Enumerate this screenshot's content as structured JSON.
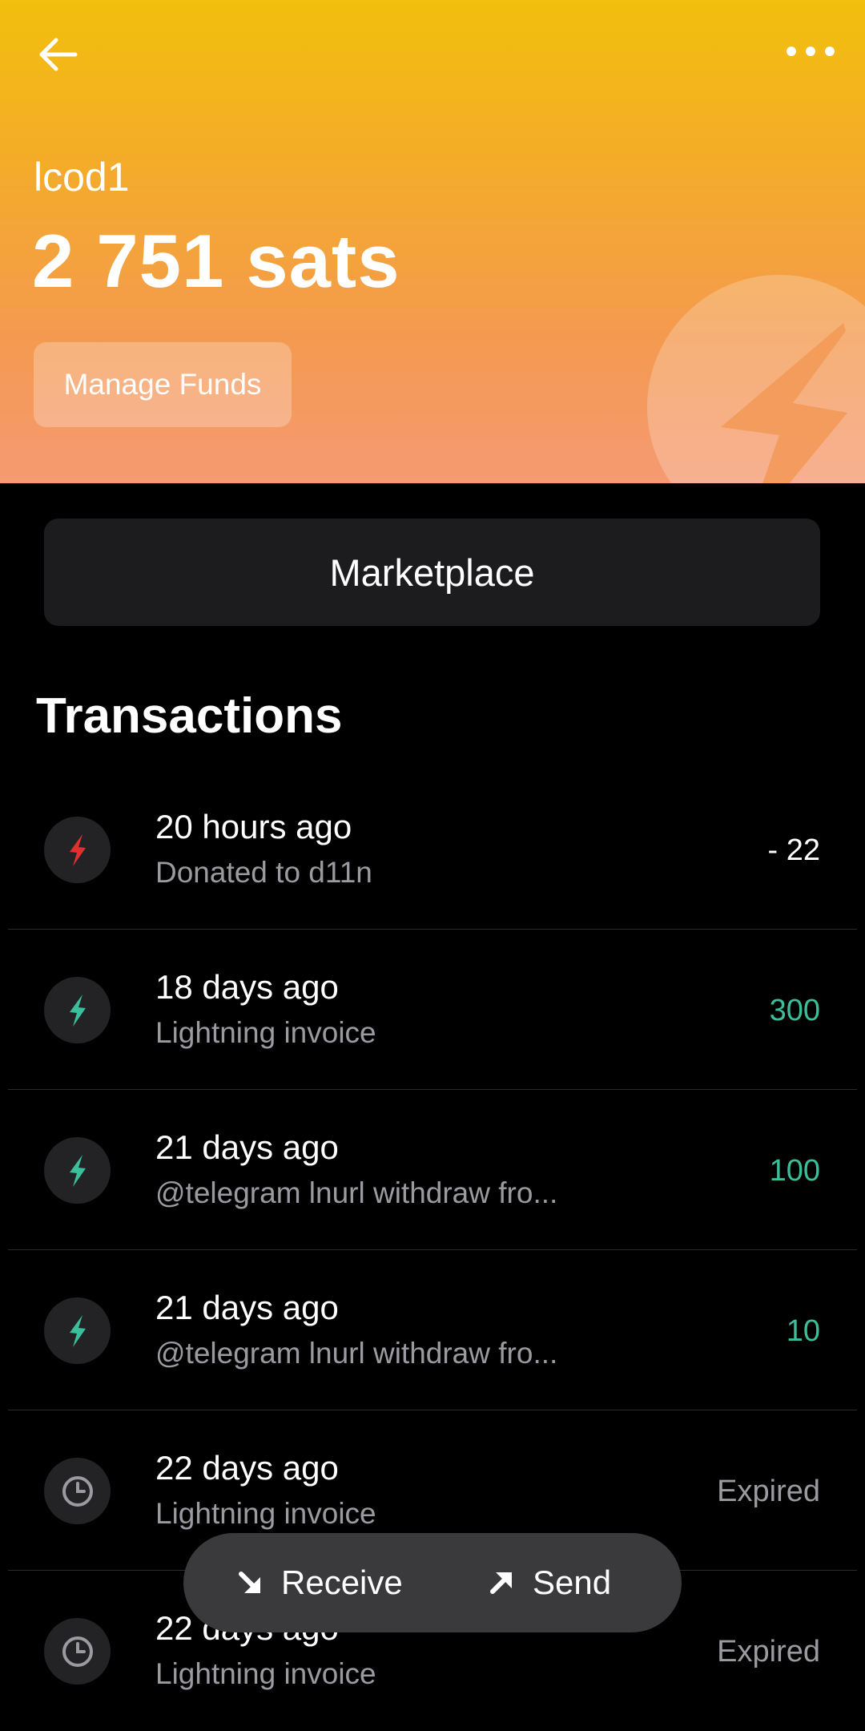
{
  "header": {
    "wallet_name": "lcod1",
    "balance": "2 751 sats",
    "manage_funds_label": "Manage Funds",
    "icons": {
      "back": "arrow-left-icon",
      "more": "more-horizontal-icon",
      "decoration": "lightning-bolt-icon"
    },
    "colors": {
      "gradient_top": "#f2bf0c",
      "gradient_bottom": "#f59a72"
    }
  },
  "marketplace_label": "Marketplace",
  "transactions_title": "Transactions",
  "transactions": [
    {
      "time": "20 hours ago",
      "description": "Donated to d11n",
      "amount": "- 22",
      "type": "outgoing",
      "icon": "lightning-bolt-icon",
      "icon_color": "#e0302e"
    },
    {
      "time": "18 days ago",
      "description": "Lightning invoice",
      "amount": "300",
      "type": "incoming",
      "icon": "lightning-bolt-icon",
      "icon_color": "#3bbf9a"
    },
    {
      "time": "21 days ago",
      "description": "@telegram lnurl withdraw fro...",
      "amount": "100",
      "type": "incoming",
      "icon": "lightning-bolt-icon",
      "icon_color": "#3bbf9a"
    },
    {
      "time": "21 days ago",
      "description": "@telegram lnurl withdraw fro...",
      "amount": "10",
      "type": "incoming",
      "icon": "lightning-bolt-icon",
      "icon_color": "#3bbf9a"
    },
    {
      "time": "22 days ago",
      "description": "Lightning invoice",
      "amount": "Expired",
      "type": "expired",
      "icon": "clock-icon",
      "icon_color": "#9a9aa0"
    },
    {
      "time": "22 days ago",
      "description": "Lightning invoice",
      "amount": "Expired",
      "type": "expired",
      "icon": "clock-icon",
      "icon_color": "#9a9aa0"
    }
  ],
  "actions": {
    "receive_label": "Receive",
    "send_label": "Send",
    "receive_icon": "arrow-down-right-icon",
    "send_icon": "arrow-up-right-icon"
  }
}
